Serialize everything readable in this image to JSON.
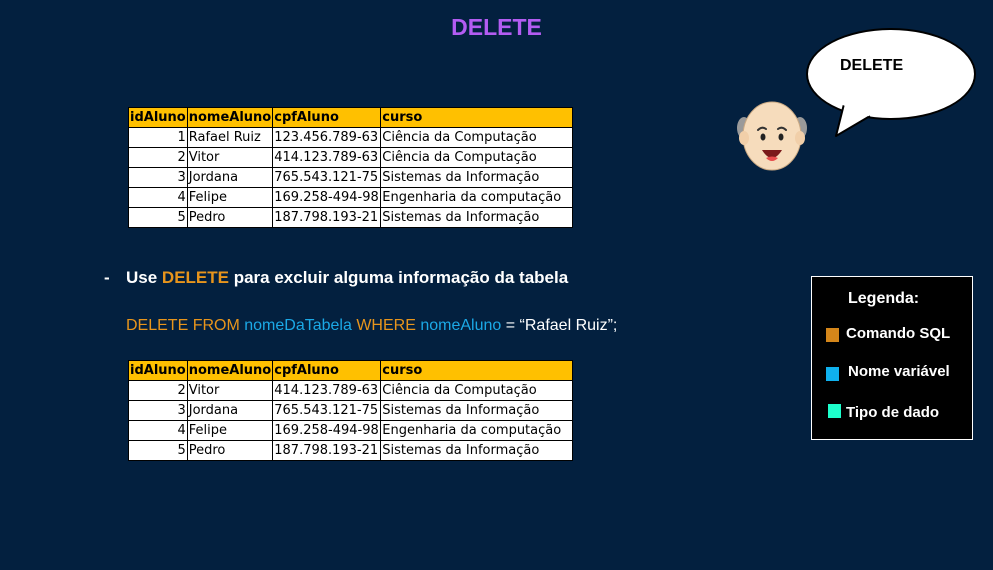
{
  "title": "DELETE",
  "speech_bubble": "DELETE",
  "table_headers": [
    "idAluno",
    "nomeAluno",
    "cpfAluno",
    "curso"
  ],
  "table_before": [
    {
      "id": "1",
      "nome": "Rafael Ruiz",
      "cpf": "123.456.789-63",
      "curso": "Ciência da Computação"
    },
    {
      "id": "2",
      "nome": "Vitor",
      "cpf": "414.123.789-63",
      "curso": "Ciência da Computação"
    },
    {
      "id": "3",
      "nome": "Jordana",
      "cpf": "765.543.121-75",
      "curso": "Sistemas da Informação"
    },
    {
      "id": "4",
      "nome": "Felipe",
      "cpf": "169.258-494-98",
      "curso": "Engenharia da computação"
    },
    {
      "id": "5",
      "nome": "Pedro",
      "cpf": "187.798.193-21",
      "curso": "Sistemas da Informação"
    }
  ],
  "table_after": [
    {
      "id": "2",
      "nome": "Vitor",
      "cpf": "414.123.789-63",
      "curso": "Ciência da Computação"
    },
    {
      "id": "3",
      "nome": "Jordana",
      "cpf": "765.543.121-75",
      "curso": "Sistemas da Informação"
    },
    {
      "id": "4",
      "nome": "Felipe",
      "cpf": "169.258-494-98",
      "curso": "Engenharia da computação"
    },
    {
      "id": "5",
      "nome": "Pedro",
      "cpf": "187.798.193-21",
      "curso": "Sistemas da Informação"
    }
  ],
  "bullet": {
    "dash": "-",
    "prefix": "Use ",
    "keyword": "DELETE",
    "suffix": " para excluir alguma informação da tabela"
  },
  "sql": {
    "kw1": "DELETE FROM",
    "table": "nomeDaTabela",
    "kw2": "WHERE",
    "column": "nomeAluno",
    "rest": "= “Rafael Ruiz”;"
  },
  "legend": {
    "title": "Legenda:",
    "items": [
      {
        "label": "Comando SQL",
        "color": "#d4861a"
      },
      {
        "label": "Nome variável",
        "color": "#0fb1ee"
      },
      {
        "label": "Tipo de dado",
        "color": "#1dffcc"
      }
    ]
  },
  "colors": {
    "background": "#03203f",
    "title": "#b35cf2",
    "header_fill": "#ffc000",
    "sql_keyword": "#e8951c",
    "variable": "#1ba9e6"
  },
  "icons": [
    "speech-bubble",
    "bald-man-avatar"
  ]
}
